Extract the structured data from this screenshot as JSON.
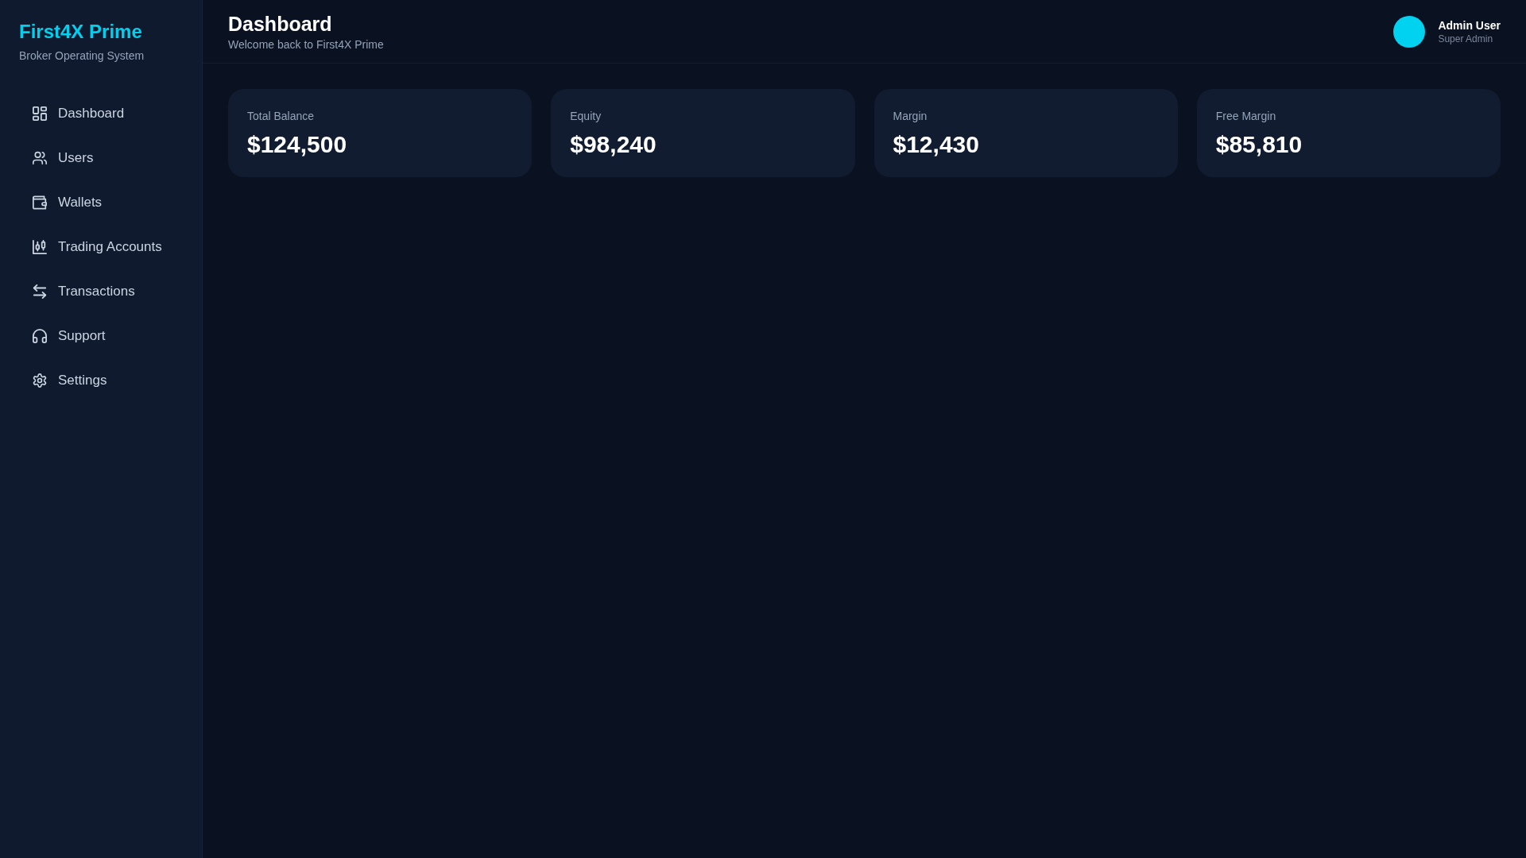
{
  "sidebar": {
    "logo": "First4X Prime",
    "tagline": "Broker Operating System",
    "items": [
      {
        "label": "Dashboard",
        "selected": false
      },
      {
        "label": "Users",
        "selected": false
      },
      {
        "label": "Wallets",
        "selected": false
      },
      {
        "label": "Trading Accounts",
        "selected": false
      },
      {
        "label": "Transactions",
        "selected": false
      },
      {
        "label": "Support",
        "selected": false
      },
      {
        "label": "Settings",
        "selected": false
      }
    ]
  },
  "header": {
    "title": "Dashboard",
    "subtitle": "Welcome back to First4X Prime",
    "user": {
      "name": "Admin User",
      "role": "Super Admin"
    }
  },
  "stats": [
    {
      "label": "Total Balance",
      "value": "$124,500"
    },
    {
      "label": "Equity",
      "value": "$98,240"
    },
    {
      "label": "Margin",
      "value": "$12,430"
    },
    {
      "label": "Free Margin",
      "value": "$85,810"
    }
  ]
}
